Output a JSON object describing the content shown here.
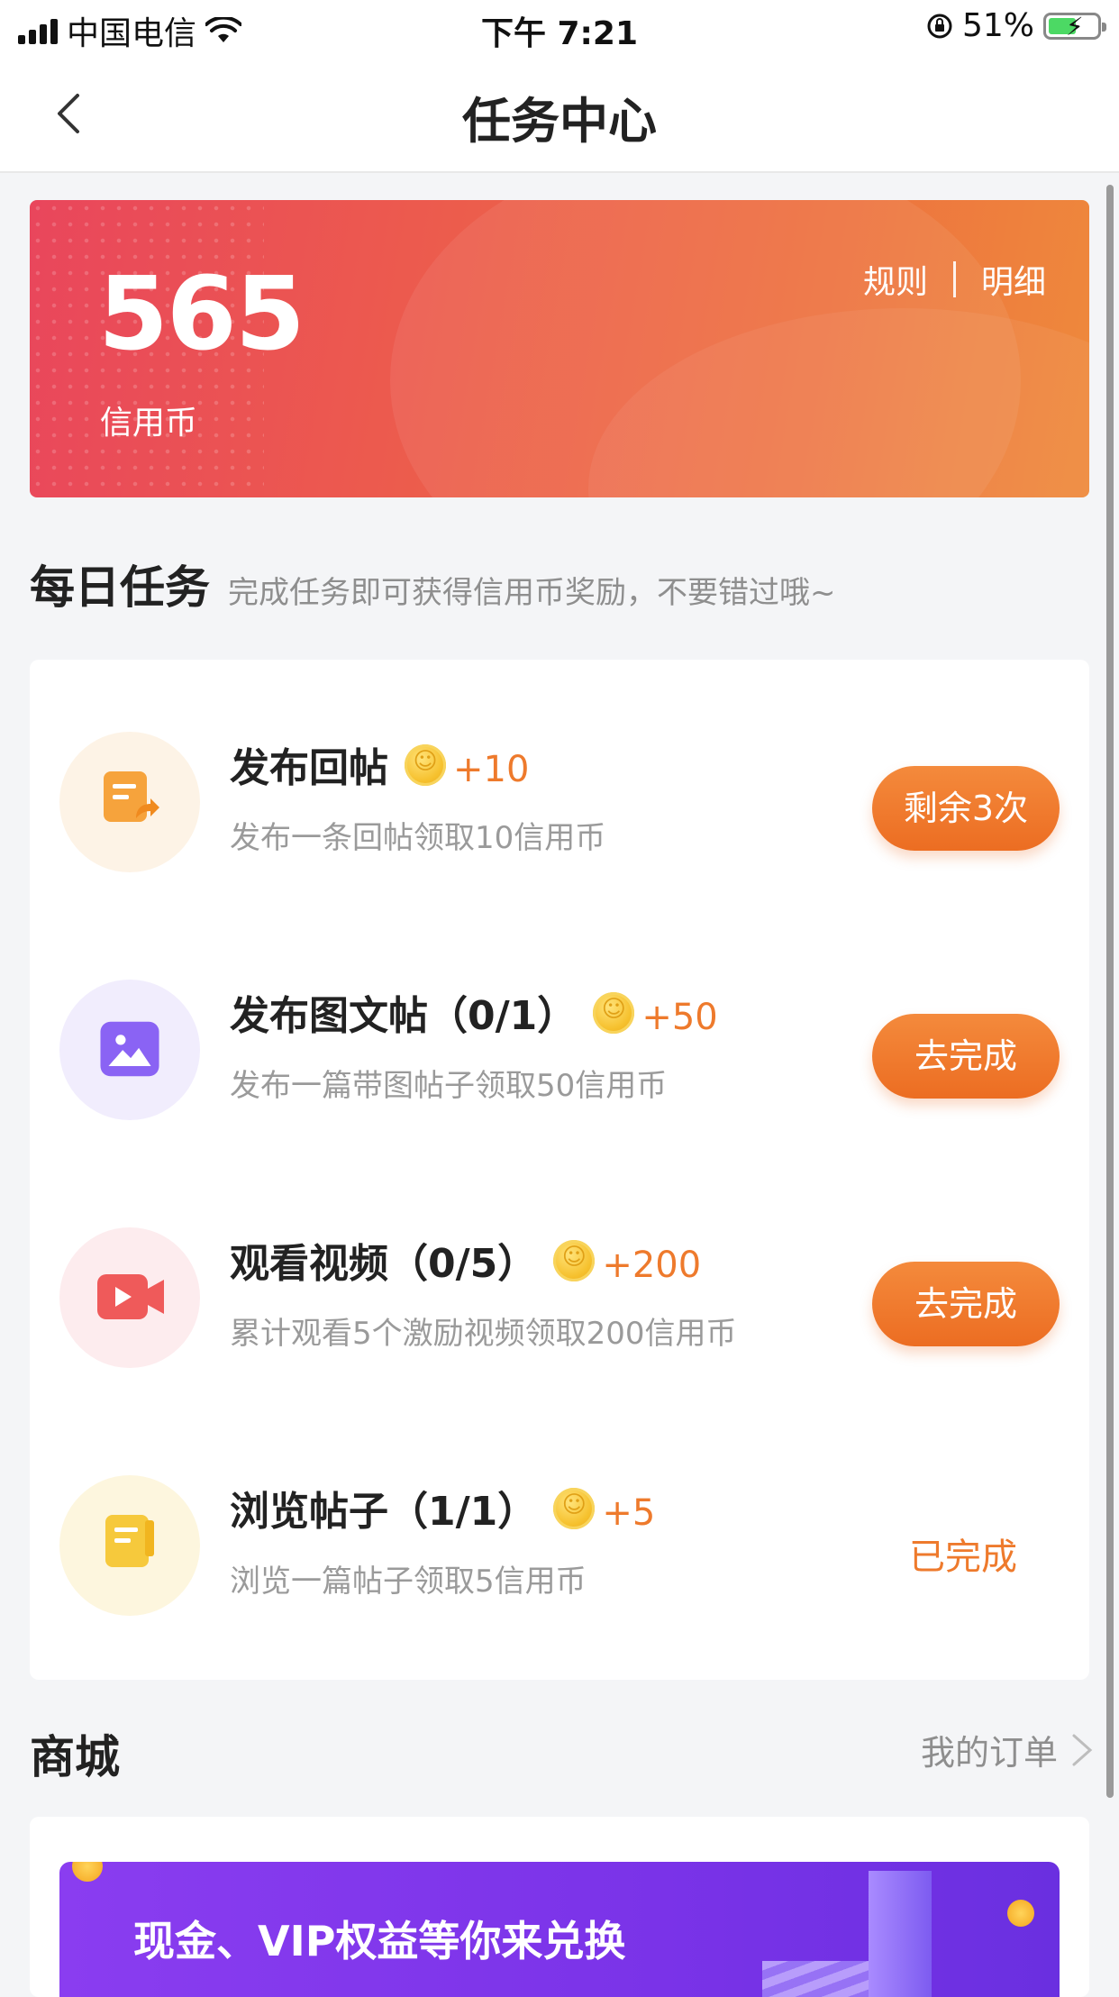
{
  "status_bar": {
    "carrier": "中国电信",
    "time": "下午 7:21",
    "battery": "51%"
  },
  "nav": {
    "title": "任务中心"
  },
  "credit": {
    "amount": "565",
    "unit": "信用币",
    "rules_label": "规则",
    "detail_label": "明细"
  },
  "daily": {
    "title": "每日任务",
    "subtitle": "完成任务即可获得信用币奖励，不要错过哦~"
  },
  "tasks": [
    {
      "title": "发布回帖",
      "reward": "+10",
      "desc": "发布一条回帖领取10信用币",
      "action": "剩余3次",
      "icon": "reply-post-icon",
      "color": "#f6a33c"
    },
    {
      "title": "发布图文帖（0/1）",
      "reward": "+50",
      "desc": "发布一篇带图帖子领取50信用币",
      "action": "去完成",
      "icon": "image-post-icon",
      "color": "#8a63f4"
    },
    {
      "title": "观看视频（0/5）",
      "reward": "+200",
      "desc": "累计观看5个激励视频领取200信用币",
      "action": "去完成",
      "icon": "video-icon",
      "color": "#ef5a5a"
    },
    {
      "title": "浏览帖子（1/1）",
      "reward": "+5",
      "desc": "浏览一篇帖子领取5信用币",
      "action": "已完成",
      "icon": "browse-post-icon",
      "color": "#f6c93c"
    }
  ],
  "shop": {
    "title": "商城",
    "orders_label": "我的订单",
    "banner_text": "现金、VIP权益等你来兑换"
  },
  "colors": {
    "accent": "#ee7a2c",
    "card_gradient_start": "#e9465c",
    "card_gradient_end": "#ee8a3c",
    "banner_purple": "#7a33e8"
  }
}
